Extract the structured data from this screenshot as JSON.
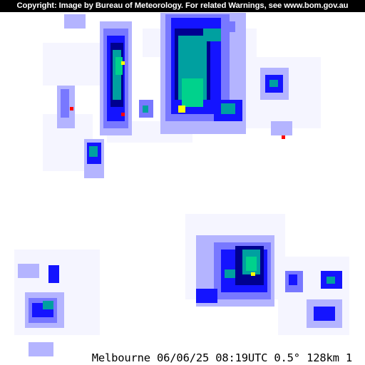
{
  "copyright": "Copyright: Image by Bureau of Meteorology. For related Warnings, see www.bom.gov.au",
  "footer": "Melbourne 06/06/25 08:19UTC 0.5° 128km 1",
  "colors": {
    "background": "#ffffff",
    "light": "#f5f5ff",
    "lightest_blue": "#b4b4ff",
    "light_blue": "#7878ff",
    "blue": "#1414ff",
    "navy": "#000090",
    "teal": "#00a0a0",
    "green": "#00d28c",
    "yellow": "#ffff00",
    "red": "#ff0000"
  }
}
